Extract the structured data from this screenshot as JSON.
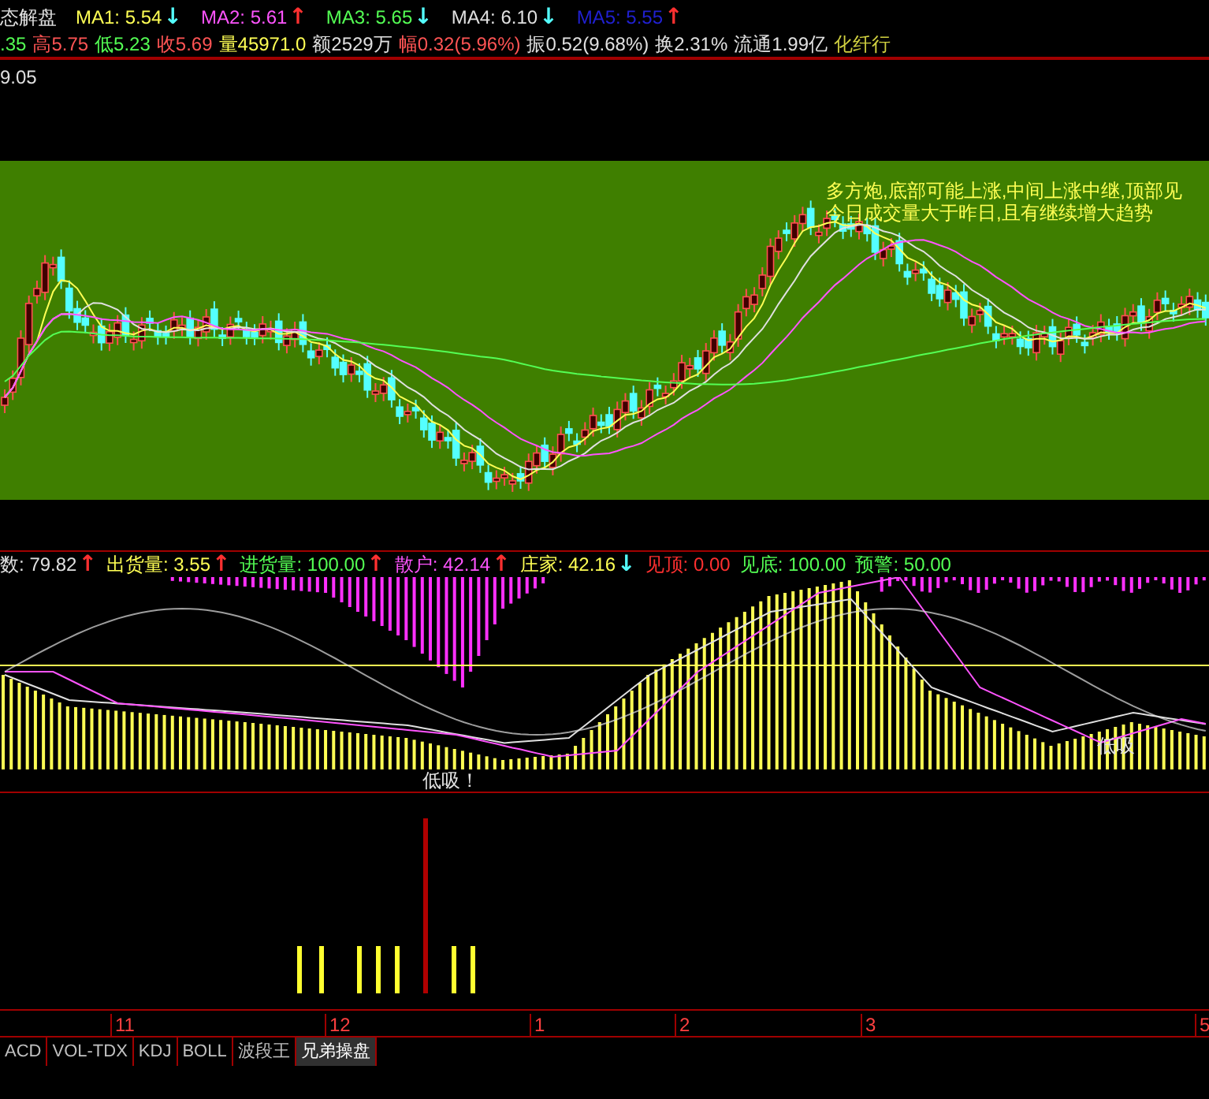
{
  "header": {
    "title": "态解盘",
    "ma": [
      {
        "label": "MA1:",
        "value": "5.54",
        "arrow": {
          "text": "↓",
          "color": "#54ffff"
        },
        "color": "#ffff54"
      },
      {
        "label": "MA2:",
        "value": "5.61",
        "arrow": {
          "text": "↑",
          "color": "#ff3030"
        },
        "color": "#ff54ff"
      },
      {
        "label": "MA3:",
        "value": "5.65",
        "arrow": {
          "text": "↓",
          "color": "#54ffff"
        },
        "color": "#54ff54"
      },
      {
        "label": "MA4:",
        "value": "6.10",
        "arrow": {
          "text": "↓",
          "color": "#54ffff"
        },
        "color": "#e0e0e0"
      },
      {
        "label": "MA5:",
        "value": "5.55",
        "arrow": {
          "text": "↑",
          "color": "#ff3030"
        },
        "color": "#2020d0"
      }
    ],
    "quote": [
      {
        "text": ".35",
        "color": "#54ff54"
      },
      {
        "text": "高5.75",
        "color": "#ff5454"
      },
      {
        "text": "低5.23",
        "color": "#54ff54"
      },
      {
        "text": "收5.69",
        "color": "#ff5454"
      },
      {
        "text": "量45971.0",
        "color": "#ffff54"
      },
      {
        "text": "额2529万",
        "color": "#e0e0e0"
      },
      {
        "text": "幅0.32(5.96%)",
        "color": "#ff5454"
      },
      {
        "text": "振0.52(9.68%)",
        "color": "#e0e0e0"
      },
      {
        "text": "换2.31%",
        "color": "#e0e0e0"
      },
      {
        "text": "流通1.99亿",
        "color": "#e0e0e0"
      },
      {
        "text": "化纤行",
        "color": "#d0d040"
      }
    ]
  },
  "main_chart": {
    "price_label": "9.05",
    "notes": [
      "多方炮,底部可能上涨,中间上涨中继,顶部见",
      "今日成交量大于昨日,且有继续增大趋势"
    ]
  },
  "indicator": {
    "items": [
      {
        "label": "数:",
        "value": "79.82",
        "arrow": {
          "text": "↑",
          "color": "#ff3030"
        },
        "color": "#e0e0e0"
      },
      {
        "label": "出货量:",
        "value": "3.55",
        "arrow": {
          "text": "↑",
          "color": "#ff3030"
        },
        "color": "#ffff54"
      },
      {
        "label": "进货量:",
        "value": "100.00",
        "arrow": {
          "text": "↑",
          "color": "#ff3030"
        },
        "color": "#54ff54"
      },
      {
        "label": "散户:",
        "value": "42.14",
        "arrow": {
          "text": "↑",
          "color": "#ff3030"
        },
        "color": "#ff54ff"
      },
      {
        "label": "庄家:",
        "value": "42.16",
        "arrow": {
          "text": "↓",
          "color": "#54ffff"
        },
        "color": "#ffff54"
      },
      {
        "label": "见顶:",
        "value": "0.00",
        "color": "#ff3030"
      },
      {
        "label": "见底:",
        "value": "100.00",
        "color": "#54ff54"
      },
      {
        "label": "预警:",
        "value": "50.00",
        "color": "#54ff54"
      }
    ],
    "marks": [
      "低吸！",
      "低吸"
    ]
  },
  "x_axis": [
    "11",
    "12",
    "1",
    "2",
    "3",
    "5"
  ],
  "tabs": [
    {
      "label": "ACD",
      "selected": false
    },
    {
      "label": "VOL-TDX",
      "selected": false
    },
    {
      "label": "KDJ",
      "selected": false
    },
    {
      "label": "BOLL",
      "selected": false
    },
    {
      "label": "波段王",
      "selected": false
    },
    {
      "label": "兄弟操盘",
      "selected": true
    }
  ]
}
